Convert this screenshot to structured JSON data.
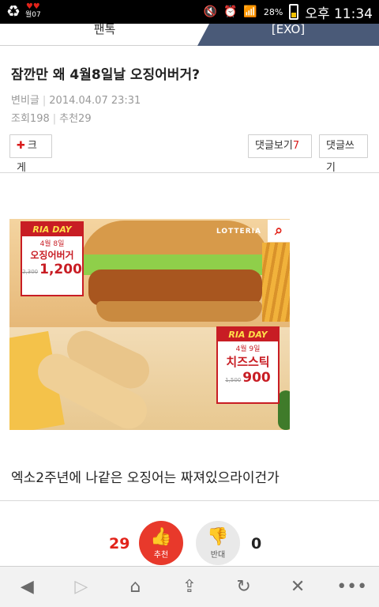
{
  "status_bar": {
    "notification_label": "월07",
    "battery": "28%",
    "time": "오후 11:34"
  },
  "tabs": {
    "left": "팬톡",
    "right": "[EXO]"
  },
  "post": {
    "title": "잠깐만 왜 4월8일날 오징어버거?",
    "author": "변비글",
    "date": "2014.04.07 23:31",
    "views": "조회198",
    "recommends": "추천29",
    "body": "엑소2주년에 나같은 오징어는 짜져있으라이건가"
  },
  "actions": {
    "enlarge": "크게",
    "view_comments": "댓글보기",
    "comment_count": "7",
    "write_comment": "댓글쓰기"
  },
  "image": {
    "brand": "LOTTERIA",
    "promo1": {
      "header": "RIA DAY",
      "date": "4월 8일",
      "name": "오징어버거",
      "old_price": "2,300",
      "price": "1,200"
    },
    "promo2": {
      "header": "RIA DAY",
      "date": "4월 9일",
      "name": "치즈스틱",
      "old_price": "1,500",
      "price": "900"
    }
  },
  "votes": {
    "up_count": "29",
    "up_label": "추천",
    "down_label": "반대",
    "down_count": "0"
  },
  "icons": {
    "recycle": "recycle-icon",
    "zoom": "search-icon",
    "back": "back-icon",
    "forward": "forward-icon",
    "home": "home-icon",
    "share": "share-icon",
    "refresh": "refresh-icon",
    "close": "close-icon",
    "more": "more-icon"
  },
  "colors": {
    "accent_red": "#e2231a",
    "tab_dark": "#4a5a78"
  }
}
